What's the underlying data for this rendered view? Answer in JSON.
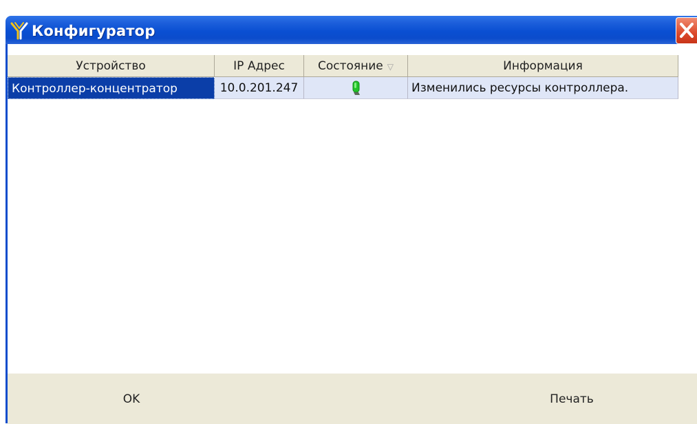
{
  "window": {
    "title": "Конфигуратор",
    "icon": "configurator-app-icon",
    "close_icon": "close-icon"
  },
  "grid": {
    "columns": [
      {
        "label": "Устройство"
      },
      {
        "label": "IP Адрес"
      },
      {
        "label": "Состояние",
        "sort_icon": "sort-descending-icon"
      },
      {
        "label": "Информация"
      }
    ],
    "rows": [
      {
        "device": "Контроллер-концентратор",
        "ip": "10.0.201.247",
        "status_icon": "green-status-indicator-icon",
        "info": "Изменились ресурсы контроллера."
      }
    ]
  },
  "buttons": {
    "ok": "OK",
    "print": "Печать"
  },
  "colors": {
    "title_bar": "#0b4ccc",
    "selection": "#0b3ea8",
    "row_background": "#dfe6f7",
    "status_green": "#22c22a",
    "close_red": "#dc4a2c"
  }
}
